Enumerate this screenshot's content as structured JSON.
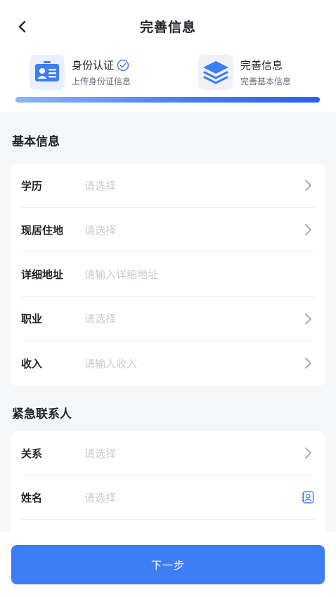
{
  "header": {
    "title": "完善信息"
  },
  "steps": [
    {
      "title": "身份认证",
      "subtitle": "上传身份证信息",
      "completed": true
    },
    {
      "title": "完善信息",
      "subtitle": "完善基本信息",
      "completed": false
    }
  ],
  "progress": 1,
  "basic": {
    "title": "基本信息",
    "rows": [
      {
        "label": "学历",
        "placeholder": "请选择"
      },
      {
        "label": "现居住地",
        "placeholder": "请选择"
      },
      {
        "label": "详细地址",
        "placeholder": "请输入详细地址"
      },
      {
        "label": "职业",
        "placeholder": "请选择"
      },
      {
        "label": "收入",
        "placeholder": "请输入收入"
      }
    ]
  },
  "emergency": {
    "title": "紧急联系人",
    "rows": [
      {
        "label": "关系",
        "placeholder": "请选择"
      },
      {
        "label": "姓名",
        "placeholder": "请选择"
      }
    ]
  },
  "footer": {
    "next_label": "下一步"
  },
  "colors": {
    "primary": "#3d7ef5",
    "placeholder": "#c7cbd1",
    "background": "#f5f6f8"
  },
  "icons": {
    "back": "chevron-left-icon",
    "step1": "id-card-icon",
    "step1_status": "check-circle-icon",
    "step2": "layers-icon",
    "row_arrow": "chevron-right-icon",
    "contacts": "contact-book-icon"
  }
}
